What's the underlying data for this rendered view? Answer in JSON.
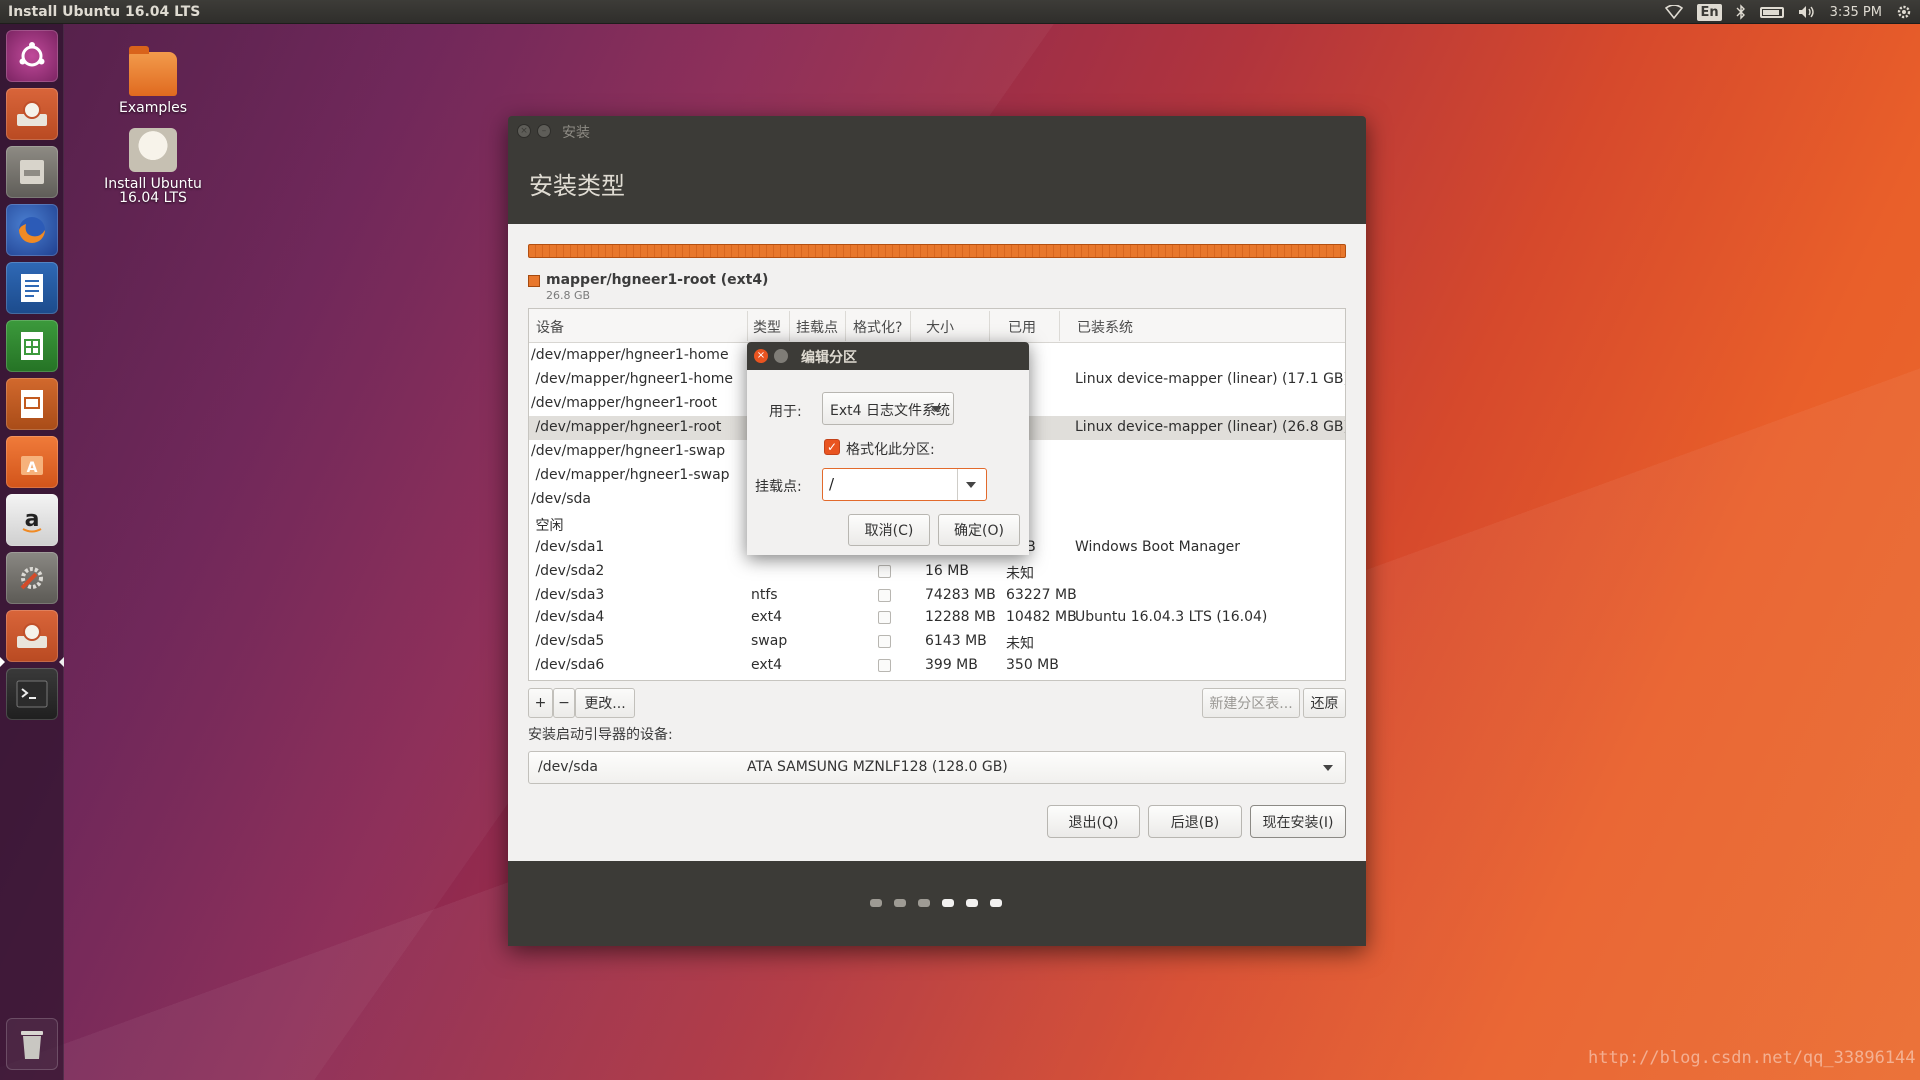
{
  "top_panel": {
    "window_title": "Install Ubuntu 16.04 LTS",
    "keyboard_layout": "En",
    "clock": "3:35 PM"
  },
  "launcher": {
    "items": [
      {
        "name": "dash-home",
        "icon": "ubuntu-logo-icon"
      },
      {
        "name": "installer",
        "icon": "installer-icon"
      },
      {
        "name": "files",
        "icon": "file-cabinet-icon"
      },
      {
        "name": "firefox",
        "icon": "firefox-icon"
      },
      {
        "name": "writer",
        "icon": "writer-document-icon"
      },
      {
        "name": "calc",
        "icon": "calc-spreadsheet-icon"
      },
      {
        "name": "impress",
        "icon": "impress-presentation-icon"
      },
      {
        "name": "software-center",
        "icon": "software-bag-icon"
      },
      {
        "name": "amazon",
        "icon": "amazon-icon"
      },
      {
        "name": "system-settings",
        "icon": "settings-wrench-icon"
      },
      {
        "name": "installer-running",
        "icon": "installer-icon"
      },
      {
        "name": "terminal",
        "icon": "terminal-icon"
      },
      {
        "name": "trash",
        "icon": "trash-icon"
      }
    ]
  },
  "desktop": {
    "examples_label": "Examples",
    "installer_label_line1": "Install Ubuntu",
    "installer_label_line2": "16.04 LTS"
  },
  "window": {
    "small_title": "安装",
    "heading": "安装类型",
    "legend_name": "mapper/hgneer1-root (ext4)",
    "legend_size": "26.8 GB",
    "columns": [
      "设备",
      "类型",
      "挂载点",
      "格式化?",
      "大小",
      "已用",
      "已装系统"
    ],
    "rows": [
      {
        "device": "/dev/mapper/hgneer1-home",
        "type": "",
        "mount": "",
        "format": null,
        "size": "",
        "used": "",
        "system": ""
      },
      {
        "device": " /dev/mapper/hgneer1-home",
        "type": "",
        "mount": "",
        "format": null,
        "size": "",
        "used": "",
        "system": "Linux device-mapper (linear) (17.1 GB)"
      },
      {
        "device": "/dev/mapper/hgneer1-root",
        "type": "",
        "mount": "",
        "format": null,
        "size": "",
        "used": "",
        "system": ""
      },
      {
        "device": " /dev/mapper/hgneer1-root",
        "type": "",
        "mount": "",
        "format": null,
        "size": "",
        "used": "",
        "system": "Linux device-mapper (linear) (26.8 GB)"
      },
      {
        "device": "/dev/mapper/hgneer1-swap",
        "type": "",
        "mount": "",
        "format": null,
        "size": "",
        "used": "",
        "system": ""
      },
      {
        "device": " /dev/mapper/hgneer1-swap",
        "type": "",
        "mount": "",
        "format": null,
        "size": "",
        "used": "",
        "system": ""
      },
      {
        "device": "/dev/sda",
        "type": "",
        "mount": "",
        "format": null,
        "size": "",
        "used": "",
        "system": ""
      },
      {
        "device": " 空闲",
        "type": "",
        "mount": "",
        "format": null,
        "size": "",
        "used": "",
        "system": ""
      },
      {
        "device": " /dev/sda1",
        "type": "",
        "mount": "",
        "format": null,
        "size": "",
        "used": "MB",
        "system": "Windows Boot Manager"
      },
      {
        "device": " /dev/sda2",
        "type": "",
        "mount": "",
        "format": false,
        "size": "16 MB",
        "used": "未知",
        "system": ""
      },
      {
        "device": " /dev/sda3",
        "type": "ntfs",
        "mount": "",
        "format": false,
        "size": "74283 MB",
        "used": "63227 MB",
        "system": ""
      },
      {
        "device": " /dev/sda4",
        "type": "ext4",
        "mount": "",
        "format": false,
        "size": "12288 MB",
        "used": "10482 MB",
        "system": "Ubuntu 16.04.3 LTS (16.04)"
      },
      {
        "device": " /dev/sda5",
        "type": "swap",
        "mount": "",
        "format": false,
        "size": "6143 MB",
        "used": "未知",
        "system": ""
      },
      {
        "device": " /dev/sda6",
        "type": "ext4",
        "mount": "",
        "format": false,
        "size": "399 MB",
        "used": "350 MB",
        "system": ""
      }
    ],
    "buttons": {
      "add": "+",
      "remove": "−",
      "change": "更改...",
      "new_table": "新建分区表...",
      "revert": "还原",
      "quit": "退出(Q)",
      "back": "后退(B)",
      "install_now": "现在安装(I)"
    },
    "boot_label": "安装启动引导器的设备:",
    "boot_device": "/dev/sda",
    "boot_description": "ATA SAMSUNG MZNLF128 (128.0 GB)"
  },
  "dialog": {
    "title": "编辑分区",
    "use_as_label": "用于:",
    "use_as_value": "Ext4 日志文件系统",
    "format_label": "格式化此分区:",
    "format_checked": true,
    "mount_label": "挂载点:",
    "mount_value": "/",
    "cancel": "取消(C)",
    "ok": "确定(O)"
  },
  "watermark": "http://blog.csdn.net/qq_33896144",
  "colors": {
    "accent": "#e95420",
    "panel": "#3c3b37",
    "window_bg": "#f2f1f0",
    "partition_bar": "#e8772c"
  }
}
